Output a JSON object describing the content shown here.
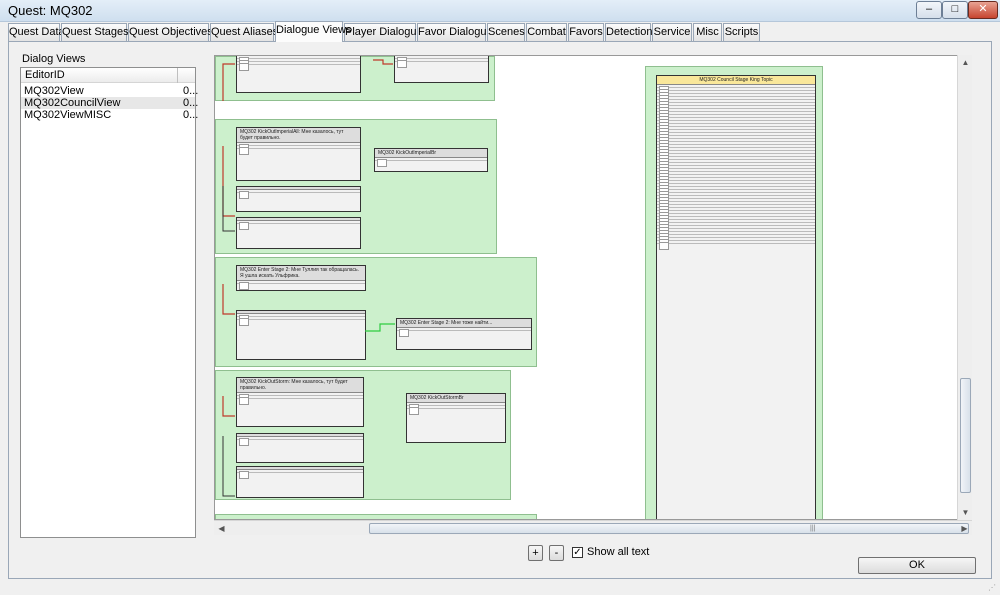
{
  "window": {
    "title": "Quest: MQ302",
    "minimize_glyph": "–",
    "maximize_glyph": "□",
    "close_glyph": "✕"
  },
  "tabs": [
    {
      "label": "Quest Data"
    },
    {
      "label": "Quest Stages"
    },
    {
      "label": "Quest Objectives"
    },
    {
      "label": "Quest Aliases"
    },
    {
      "label": "Dialogue Views"
    },
    {
      "label": "Player Dialogue"
    },
    {
      "label": "Favor Dialogue"
    },
    {
      "label": "Scenes"
    },
    {
      "label": "Combat"
    },
    {
      "label": "Favors"
    },
    {
      "label": "Detection"
    },
    {
      "label": "Service"
    },
    {
      "label": "Misc"
    },
    {
      "label": "Scripts"
    }
  ],
  "active_tab": "Dialogue Views",
  "dialog_views": {
    "label": "Dialog Views",
    "column_header": "EditorID",
    "rows": [
      {
        "name": "MQ302View",
        "value": "0..."
      },
      {
        "name": "MQ302CouncilView",
        "value": "0..."
      },
      {
        "name": "MQ302ViewMISC",
        "value": "0..."
      }
    ],
    "selected_index": 1
  },
  "canvas": {
    "groups": [
      {
        "header": ""
      },
      {
        "header": "MQ302 KickOutImperialAll: Мне казалось, тут будет правильно."
      },
      {
        "header": "MQ302 Enter Stage 2: Мне Туллия так обращалась. Я ушла искать Ульфрика."
      },
      {
        "header": "MQ302 KickOutStorm: Мне казалось, тут будет правильно."
      }
    ],
    "right_node_header": "MQ302 Council Stage King Topic",
    "node_stub": "Topic",
    "side_node_1": "MQ302 KickOutImperialBr",
    "side_node_2": "MQ302 Enter Stage 2: Mне тоже найти...",
    "side_node_3": "MQ302 KickOutStormBr"
  },
  "controls": {
    "plus": "+",
    "minus": "-",
    "show_all_text": "Show all text",
    "show_all_text_checked": true,
    "ok": "OK",
    "check_glyph": "✓"
  }
}
